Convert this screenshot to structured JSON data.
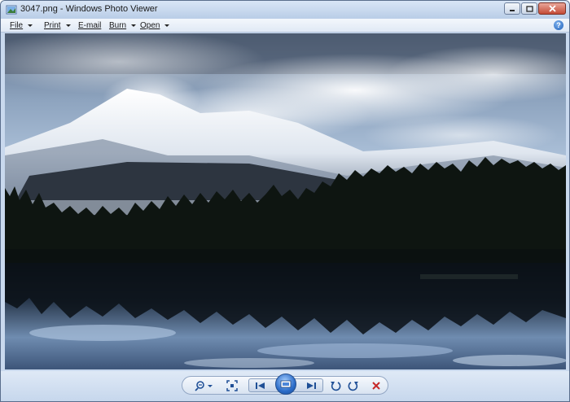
{
  "window": {
    "title": "3047.png - Windows Photo Viewer"
  },
  "menu": {
    "file": "File",
    "print": "Print",
    "email": "E-mail",
    "burn": "Burn",
    "open": "Open"
  },
  "help": "?",
  "toolbar": {
    "icons": [
      "zoom-icon",
      "fit-window-icon",
      "previous-icon",
      "slideshow-icon",
      "next-icon",
      "rotate-ccw-icon",
      "rotate-cw-icon",
      "delete-icon"
    ]
  },
  "colors": {
    "delete_accent": "#c62828",
    "window_frame": "#c9d9ee"
  }
}
